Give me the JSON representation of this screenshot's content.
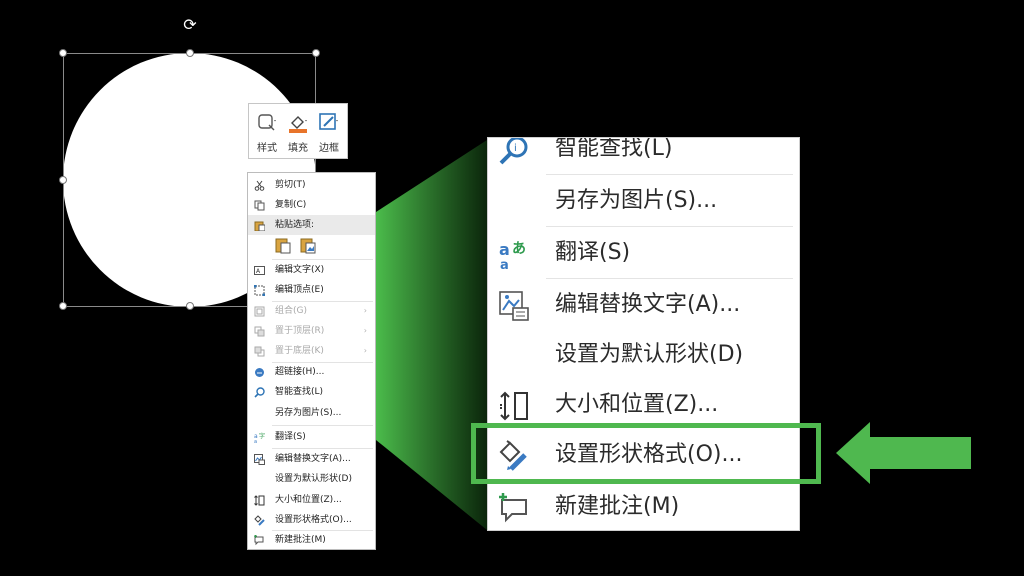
{
  "colors": {
    "accent_green": "#4fb84f",
    "background": "#000000",
    "highlight_border": "#4fb84f"
  },
  "mini_toolbar": [
    {
      "label": "样式",
      "icon": "shape-style-icon"
    },
    {
      "label": "填充",
      "icon": "fill-bucket-icon"
    },
    {
      "label": "边框",
      "icon": "border-pen-icon"
    }
  ],
  "context_menu": {
    "items": [
      {
        "label": "剪切(T)",
        "icon": "scissors-icon",
        "enabled": true
      },
      {
        "label": "复制(C)",
        "icon": "copy-icon",
        "enabled": true
      },
      {
        "label": "粘贴选项:",
        "icon": "paste-icon",
        "enabled": true
      },
      {
        "label": "编辑文字(X)",
        "icon": "edit-text-icon",
        "enabled": true
      },
      {
        "label": "编辑顶点(E)",
        "icon": "edit-points-icon",
        "enabled": true
      },
      {
        "label": "组合(G)",
        "icon": "group-icon",
        "enabled": false
      },
      {
        "label": "置于顶层(R)",
        "icon": "bring-front-icon",
        "enabled": false
      },
      {
        "label": "置于底层(K)",
        "icon": "send-back-icon",
        "enabled": false
      },
      {
        "label": "超链接(H)...",
        "icon": "hyperlink-icon",
        "enabled": true
      },
      {
        "label": "智能查找(L)",
        "icon": "smart-lookup-icon",
        "enabled": true
      },
      {
        "label": "另存为图片(S)...",
        "icon": "",
        "enabled": true
      },
      {
        "label": "翻译(S)",
        "icon": "translate-icon",
        "enabled": true
      },
      {
        "label": "编辑替换文字(A)...",
        "icon": "alt-text-icon",
        "enabled": true
      },
      {
        "label": "设置为默认形状(D)",
        "icon": "",
        "enabled": true
      },
      {
        "label": "大小和位置(Z)...",
        "icon": "size-position-icon",
        "enabled": true
      },
      {
        "label": "设置形状格式(O)...",
        "icon": "format-shape-icon",
        "enabled": true
      },
      {
        "label": "新建批注(M)",
        "icon": "new-comment-icon",
        "enabled": true
      }
    ]
  },
  "zoomed_menu": {
    "items": [
      {
        "label": "智能查找(L)",
        "icon": "smart-lookup-icon"
      },
      {
        "label": "另存为图片(S)...",
        "icon": ""
      },
      {
        "label": "翻译(S)",
        "icon": "translate-icon"
      },
      {
        "label": "编辑替换文字(A)...",
        "icon": "alt-text-icon"
      },
      {
        "label": "设置为默认形状(D)",
        "icon": ""
      },
      {
        "label": "大小和位置(Z)...",
        "icon": "size-position-icon"
      },
      {
        "label": "设置形状格式(O)...",
        "icon": "format-shape-icon"
      },
      {
        "label": "新建批注(M)",
        "icon": "new-comment-icon"
      }
    ],
    "highlighted": "设置形状格式(O)..."
  }
}
